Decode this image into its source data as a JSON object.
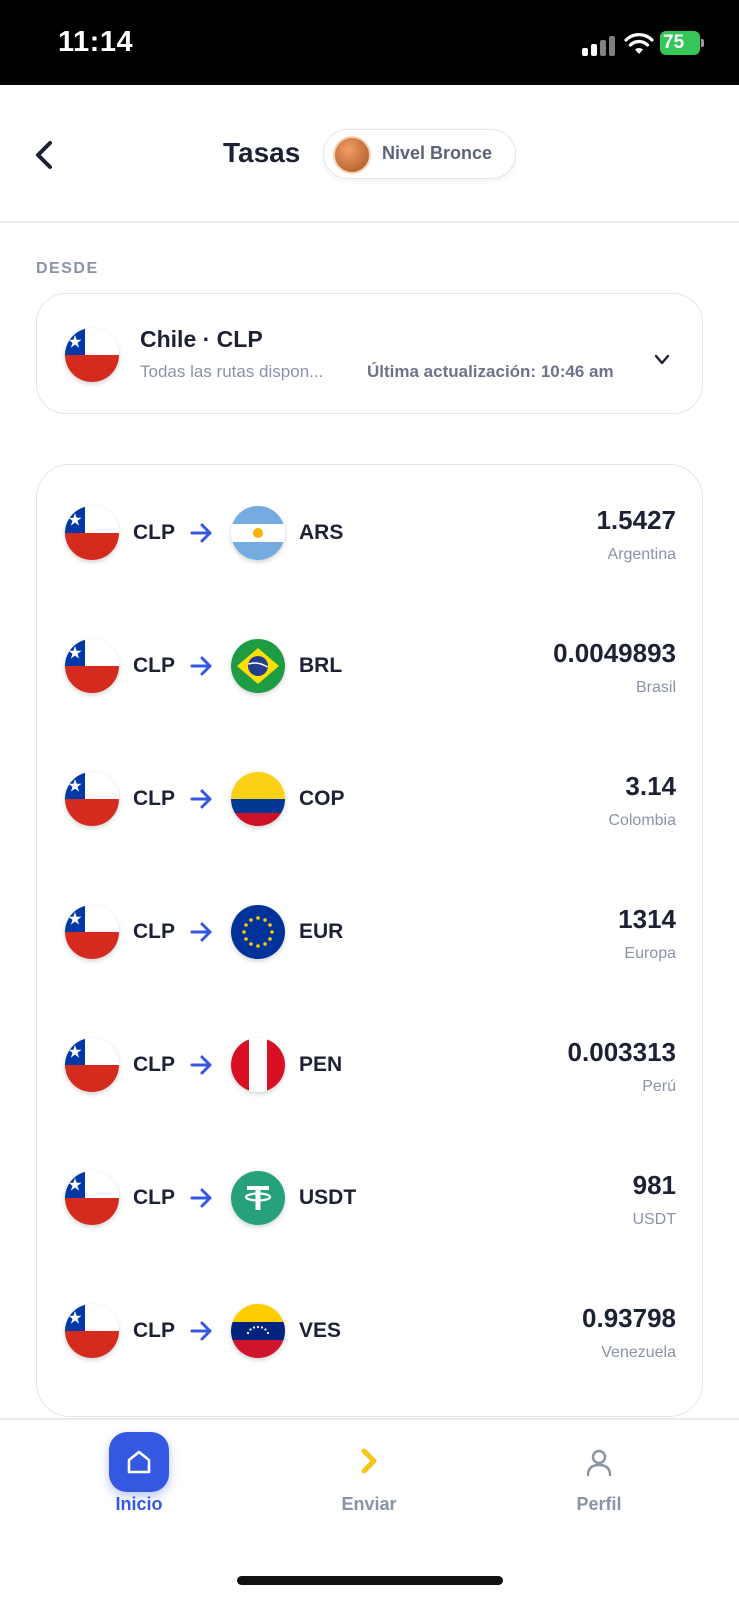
{
  "status_bar": {
    "time": "11:14",
    "battery": "75"
  },
  "header": {
    "title": "Tasas",
    "level_badge": "Nivel Bronce"
  },
  "from": {
    "section_label": "DESDE",
    "title": "Chile · CLP",
    "subtitle": "Todas las rutas dispon...",
    "last_update": "Última actualización: 10:46 am"
  },
  "rates": [
    {
      "from": "CLP",
      "to": "ARS",
      "value": "1.5427",
      "country": "Argentina",
      "flag": "argentina-flag-icon"
    },
    {
      "from": "CLP",
      "to": "BRL",
      "value": "0.0049893",
      "country": "Brasil",
      "flag": "brazil-flag-icon"
    },
    {
      "from": "CLP",
      "to": "COP",
      "value": "3.14",
      "country": "Colombia",
      "flag": "colombia-flag-icon"
    },
    {
      "from": "CLP",
      "to": "EUR",
      "value": "1314",
      "country": "Europa",
      "flag": "eu-flag-icon"
    },
    {
      "from": "CLP",
      "to": "PEN",
      "value": "0.003313",
      "country": "Perú",
      "flag": "peru-flag-icon"
    },
    {
      "from": "CLP",
      "to": "USDT",
      "value": "981",
      "country": "USDT",
      "flag": "tether-icon"
    },
    {
      "from": "CLP",
      "to": "VES",
      "value": "0.93798",
      "country": "Venezuela",
      "flag": "venezuela-flag-icon"
    }
  ],
  "nav": {
    "home": "Inicio",
    "send": "Enviar",
    "profile": "Perfil"
  },
  "colors": {
    "accent": "#3558e3",
    "send_icon": "#f5c518",
    "text_primary": "#1c2233",
    "text_muted": "#8a93a5"
  }
}
